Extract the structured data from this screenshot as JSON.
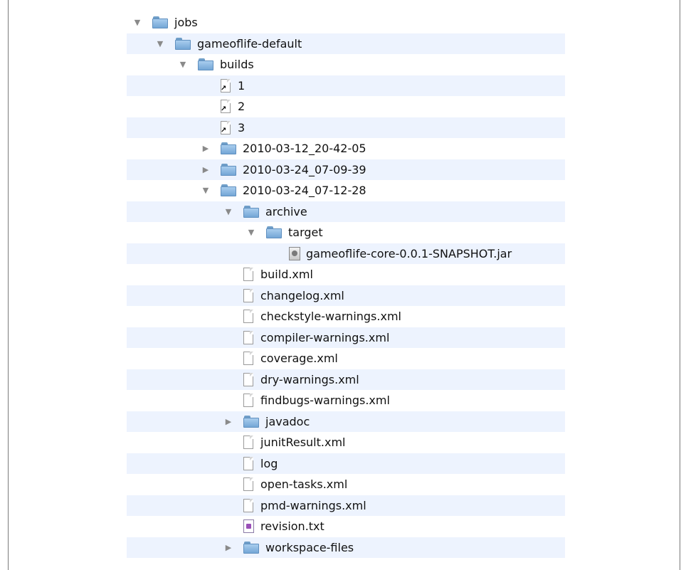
{
  "tree": [
    {
      "label": "jobs",
      "type": "folder",
      "depth": 0,
      "expanded": true
    },
    {
      "label": "gameoflife-default",
      "type": "folder",
      "depth": 1,
      "expanded": true
    },
    {
      "label": "builds",
      "type": "folder",
      "depth": 2,
      "expanded": true
    },
    {
      "label": "1",
      "type": "alias",
      "depth": 3
    },
    {
      "label": "2",
      "type": "alias",
      "depth": 3
    },
    {
      "label": "3",
      "type": "alias",
      "depth": 3
    },
    {
      "label": "2010-03-12_20-42-05",
      "type": "folder",
      "depth": 3,
      "expanded": false
    },
    {
      "label": "2010-03-24_07-09-39",
      "type": "folder",
      "depth": 3,
      "expanded": false
    },
    {
      "label": "2010-03-24_07-12-28",
      "type": "folder",
      "depth": 3,
      "expanded": true
    },
    {
      "label": "archive",
      "type": "folder",
      "depth": 4,
      "expanded": true
    },
    {
      "label": "target",
      "type": "folder",
      "depth": 5,
      "expanded": true
    },
    {
      "label": "gameoflife-core-0.0.1-SNAPSHOT.jar",
      "type": "jar",
      "depth": 6
    },
    {
      "label": "build.xml",
      "type": "file",
      "depth": 4
    },
    {
      "label": "changelog.xml",
      "type": "file",
      "depth": 4
    },
    {
      "label": "checkstyle-warnings.xml",
      "type": "file",
      "depth": 4
    },
    {
      "label": "compiler-warnings.xml",
      "type": "file",
      "depth": 4
    },
    {
      "label": "coverage.xml",
      "type": "file",
      "depth": 4
    },
    {
      "label": "dry-warnings.xml",
      "type": "file",
      "depth": 4
    },
    {
      "label": "findbugs-warnings.xml",
      "type": "file",
      "depth": 4
    },
    {
      "label": "javadoc",
      "type": "folder",
      "depth": 4,
      "expanded": false
    },
    {
      "label": "junitResult.xml",
      "type": "file",
      "depth": 4
    },
    {
      "label": "log",
      "type": "file",
      "depth": 4
    },
    {
      "label": "open-tasks.xml",
      "type": "file",
      "depth": 4
    },
    {
      "label": "pmd-warnings.xml",
      "type": "file",
      "depth": 4
    },
    {
      "label": "revision.txt",
      "type": "txt",
      "depth": 4
    },
    {
      "label": "workspace-files",
      "type": "folder",
      "depth": 4,
      "expanded": false
    }
  ],
  "colors": {
    "stripe": "#edf3fe",
    "folder": "#8bb9e3"
  }
}
